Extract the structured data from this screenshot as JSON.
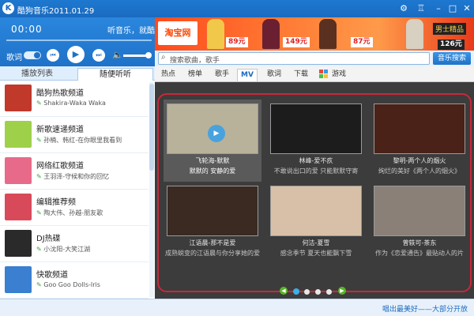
{
  "window": {
    "title": "酷狗音乐2011.01.29",
    "logo_letter": "K",
    "icons": [
      "gear-icon",
      "shirt-icon",
      "minimize-icon",
      "restore-icon",
      "close-icon"
    ]
  },
  "player": {
    "time": "00:00",
    "now_playing": "听音乐，就酷狗",
    "lyric_label": "歌词",
    "progress_fraction": 0,
    "volume_fraction": 0.85
  },
  "left_tabs": [
    "播放列表",
    "随便听听"
  ],
  "stations": [
    {
      "title": "酷狗热歌频道",
      "subtitle": "Shakira-Waka Waka",
      "thumb_color": "#c0392b"
    },
    {
      "title": "新歌速递频道",
      "subtitle": "孙楠、韩红-在你眼里我看到",
      "thumb_color": "#9fd04a"
    },
    {
      "title": "网络红歌频道",
      "subtitle": "王羽泽-守候和你的回忆",
      "thumb_color": "#e86a8a"
    },
    {
      "title": "编辑推荐频",
      "subtitle": "陶大伟、孙越-朋友歌",
      "thumb_color": "#d84a5a"
    },
    {
      "title": "DJ热碟",
      "subtitle": "小沈阳-大笑江湖",
      "thumb_color": "#2a2a2a"
    },
    {
      "title": "快歌频道",
      "subtitle": "Goo Goo Dolls-Iris",
      "thumb_color": "#3a7fd0"
    }
  ],
  "banner": {
    "brand": "淘宝网",
    "prices": [
      "89元",
      "149元",
      "87元",
      "126元"
    ],
    "label": "男士精品"
  },
  "search": {
    "placeholder": "搜索歌曲，歌手",
    "button": "音乐搜索"
  },
  "nav_tabs": [
    "热点",
    "榜单",
    "歌手",
    "MV",
    "歌词",
    "下载",
    "游戏"
  ],
  "active_nav_tab": "MV",
  "mv_items": [
    {
      "title": "飞轮海-默默",
      "desc": "默默的 安静的爱",
      "thumb_color": "#b8b29a"
    },
    {
      "title": "林峰-爱不疚",
      "desc": "不敢说出口的爱 只能默默守寄",
      "thumb_color": "#1c1c1c"
    },
    {
      "title": "黎明-两个人的烟火",
      "desc": "绚烂的美好《两个人的烟火》",
      "thumb_color": "#4a2218"
    },
    {
      "title": "江语晨-那不是爱",
      "desc": "成熟蜕变的江语晨与你分享她的爱",
      "thumb_color": "#3a2a22"
    },
    {
      "title": "何洁-夏雪",
      "desc": "感念季节 夏天也能飘下雪",
      "thumb_color": "#d8c0a8"
    },
    {
      "title": "曾轶可-茶东",
      "desc": "作为《恋爱通告》最贴动人的片",
      "thumb_color": "#8a8078"
    }
  ],
  "pager": {
    "pages": 4,
    "active": 1
  },
  "status": "唱出最美好——大部分开放"
}
